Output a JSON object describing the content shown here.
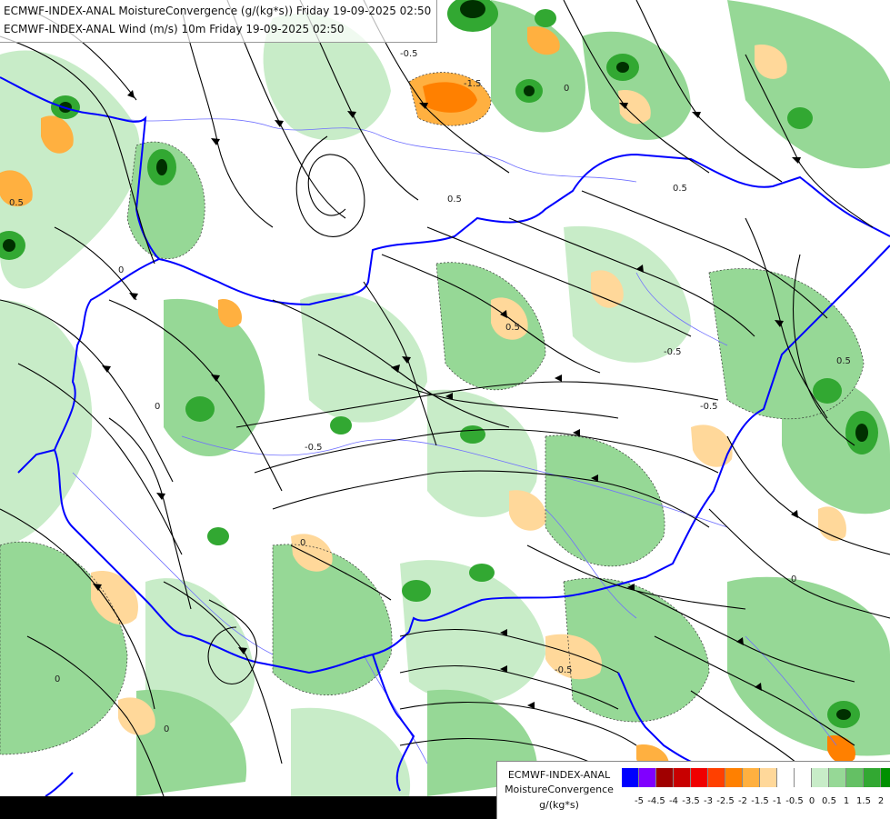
{
  "header": {
    "line1": "ECMWF-INDEX-ANAL MoistureConvergence (g/(kg*s)) Friday 19-09-2025 02:50",
    "line2": "ECMWF-INDEX-ANAL Wind (m/s) 10m Friday 19-09-2025 02:50"
  },
  "legend": {
    "model": "ECMWF-INDEX-ANAL",
    "parameter": "MoistureConvergence",
    "unit": "g/(kg*s)",
    "colors": [
      "#0000ff",
      "#8000ff",
      "#a00000",
      "#c80000",
      "#f00000",
      "#ff4000",
      "#ff8000",
      "#ffb040",
      "#ffd89a",
      "#ffffff",
      "#ffffff",
      "#c8ecc8",
      "#96d896",
      "#64c064",
      "#32a832",
      "#009000"
    ],
    "tick_labels": [
      "-5",
      "-4.5",
      "-4",
      "-3.5",
      "-3",
      "-2.5",
      "-2",
      "-1.5",
      "-1",
      "-0.5",
      "0",
      "0.5",
      "1",
      "1.5",
      "2"
    ]
  },
  "contour_labels": [
    "0.5",
    "0",
    "-0.5",
    "-1.5",
    "0.5",
    "0",
    "-0.5",
    "0",
    "0.5",
    "0",
    "-0.5",
    "0.5",
    "0",
    "-0.5",
    "0.5",
    "0",
    "-0.5",
    "0"
  ],
  "colors": {
    "border": "#0000ff",
    "rivers": "#6f6fff",
    "streamlines": "#000000",
    "green": "#96d896",
    "green_light": "#c8ecc8",
    "green_dark": "#32a832",
    "orange": "#ffb040",
    "orange_light": "#ffd89a",
    "black_center": "#003000"
  }
}
